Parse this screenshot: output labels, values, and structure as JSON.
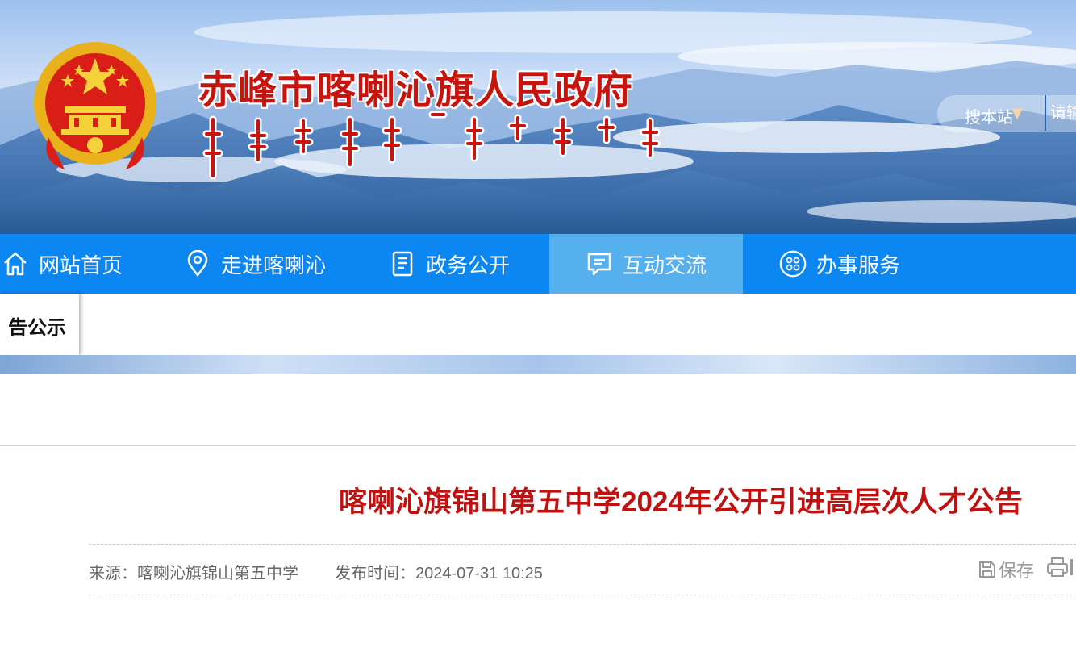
{
  "header": {
    "site_title": "赤峰市喀喇沁旗人民政府",
    "search_scope": "搜本站",
    "search_placeholder": "请输入关键词"
  },
  "nav": {
    "items": [
      {
        "label": "网站首页",
        "icon": "home-icon"
      },
      {
        "label": "走进喀喇沁",
        "icon": "location-pin-icon"
      },
      {
        "label": "政务公开",
        "icon": "document-icon"
      },
      {
        "label": "互动交流",
        "icon": "chat-icon",
        "active": true
      },
      {
        "label": "办事服务",
        "icon": "grid-services-icon"
      }
    ]
  },
  "sub_tab": {
    "label": "告公示"
  },
  "article": {
    "title": "喀喇沁旗锦山第五中学2024年公开引进高层次人才公告",
    "source": "来源：喀喇沁旗锦山第五中学",
    "publish_time": "发布时间：2024-07-31 10:25",
    "save_label": "保存"
  },
  "colors": {
    "nav_bg": "#0c86f0",
    "nav_active_bg": "#56b0ee",
    "title_red": "#c0100f",
    "site_title_red": "#c8140f"
  }
}
